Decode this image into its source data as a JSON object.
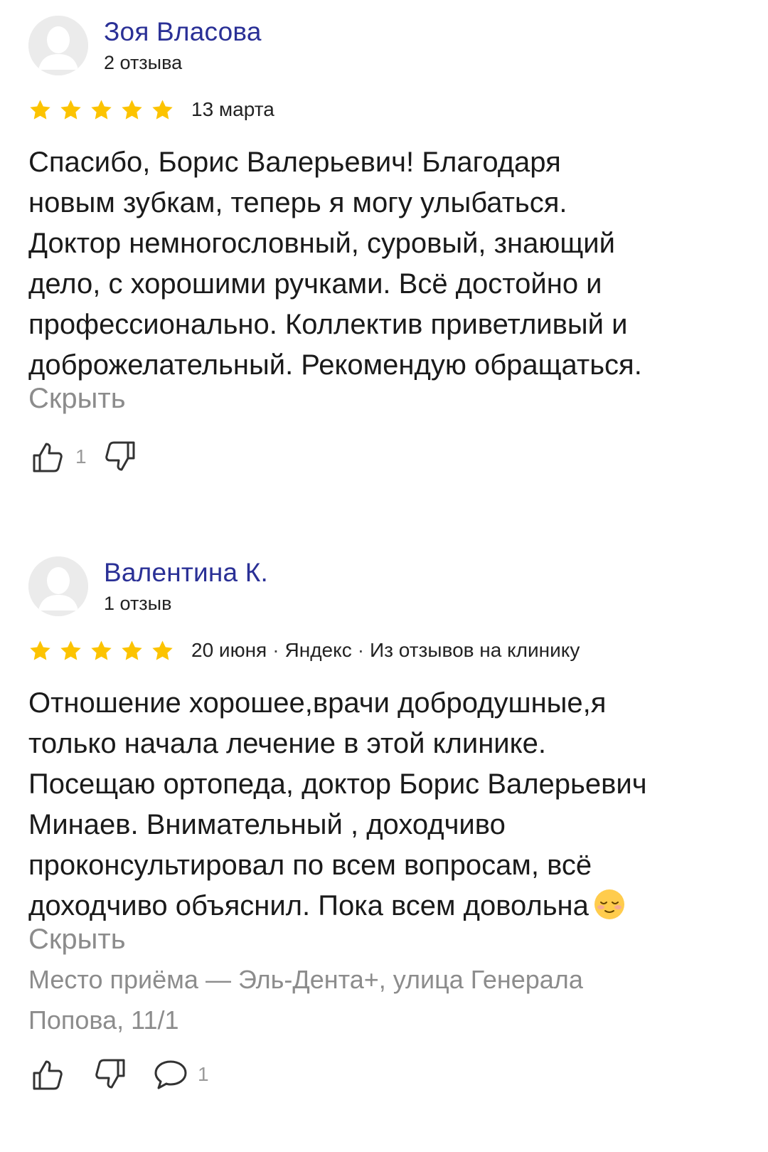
{
  "reviews": [
    {
      "author_name": "Зоя Власова",
      "author_reviews": "2 отзыва",
      "rating": 5,
      "date": "13 марта",
      "text_lines": [
        "Спасибо, Борис Валерьевич! Благодаря",
        "новым зубкам, теперь я могу улыбаться.",
        "Доктор немногословный, суровый, знающий",
        "дело, с хорошими ручками. Всё достойно и",
        "профессионально. Коллектив приветливый и",
        "доброжелательный. Рекомендую обращаться."
      ],
      "hide_label": "Скрыть",
      "likes": "1"
    },
    {
      "author_name": "Валентина К.",
      "author_reviews": "1 отзыв",
      "rating": 5,
      "date": "20 июня",
      "source": "Яндекс",
      "origin": "Из отзывов на клинику",
      "text_lines": [
        "Отношение хорошее,врачи добродушные,я",
        "только начала лечение в этой клинике.",
        "Посещаю ортопеда, доктор Борис Валерьевич",
        "Минаев. Внимательный , доходчиво",
        "проконсультировал по всем вопросам, всё",
        "доходчиво объяснил. Пока всем довольна"
      ],
      "hide_label": "Скрыть",
      "place_lines": [
        "Место приёма — Эль-Дента+, улица Генерала",
        "Попова, 11/1"
      ],
      "comments": "1"
    }
  ],
  "colors": {
    "author_name": "#2a3096",
    "star": "#fcc300",
    "muted": "#8c8c8c"
  }
}
